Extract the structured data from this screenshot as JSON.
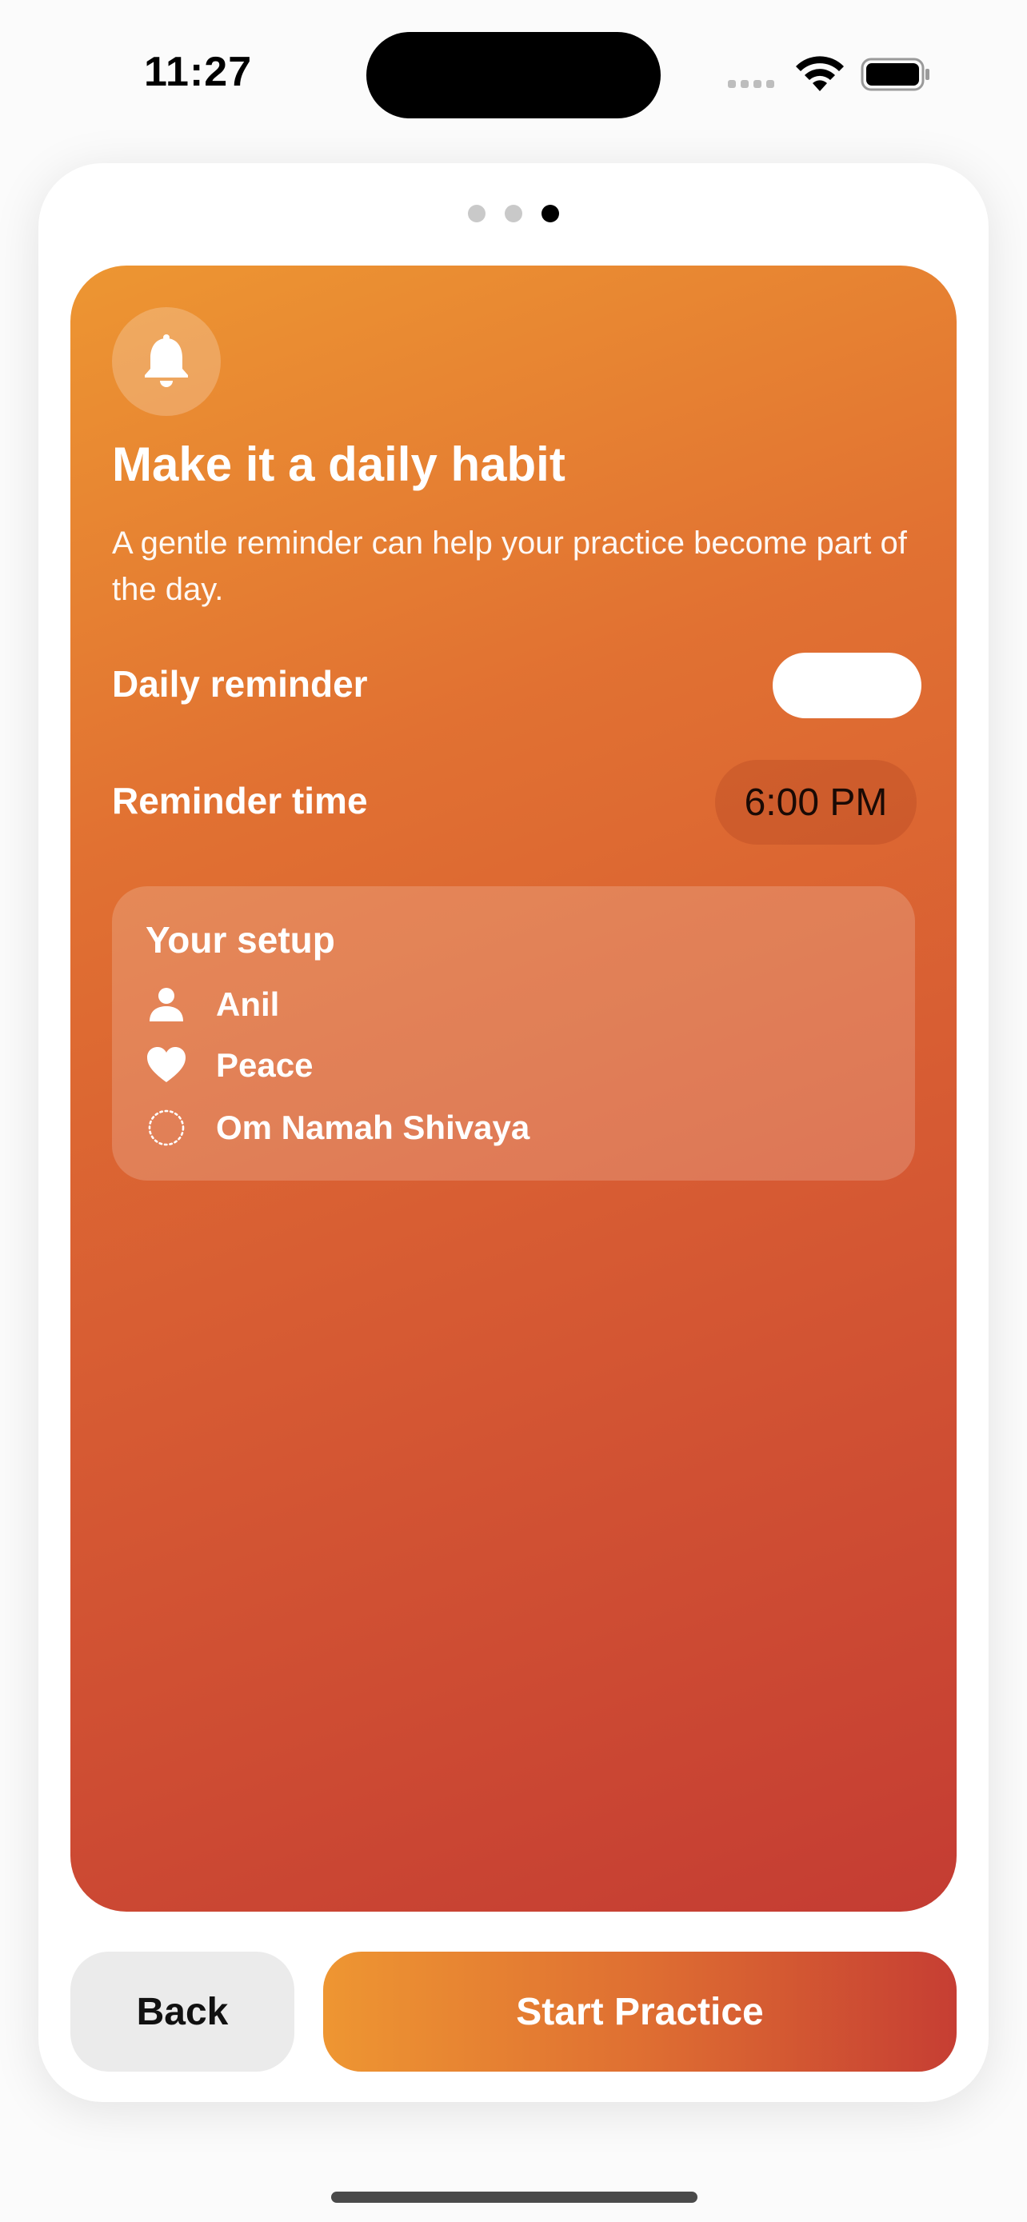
{
  "status_bar": {
    "time": "11:27",
    "icons": [
      "cellular-icon",
      "wifi-icon",
      "battery-icon"
    ]
  },
  "pager": {
    "total": 3,
    "current": 3
  },
  "hero": {
    "icon": "bell-icon",
    "title": "Make it a daily habit",
    "subtitle": "A gentle reminder can help your practice become part of the day.",
    "daily_reminder_label": "Daily reminder",
    "daily_reminder_on": true,
    "reminder_time_label": "Reminder time",
    "reminder_time_value": "6:00 PM"
  },
  "setup": {
    "title": "Your setup",
    "items": [
      {
        "icon": "person-icon",
        "label": "Anil"
      },
      {
        "icon": "heart-icon",
        "label": "Peace"
      },
      {
        "icon": "dotted-circle-icon",
        "label": "Om Namah Shivaya"
      }
    ]
  },
  "buttons": {
    "back": "Back",
    "start": "Start Practice"
  },
  "colors": {
    "gradient_start": "#ed9632",
    "gradient_end": "#c43c33",
    "back_button_bg": "#ebebeb"
  }
}
